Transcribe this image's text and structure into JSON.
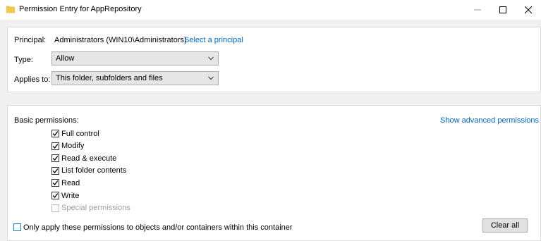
{
  "window": {
    "title": "Permission Entry for AppRepository",
    "icon": "folder-icon",
    "controls": [
      "minimize-icon",
      "maximize-icon",
      "close-icon"
    ]
  },
  "principal": {
    "label": "Principal:",
    "value": "Administrators (WIN10\\Administrators)",
    "link": "Select a principal"
  },
  "type": {
    "label": "Type:",
    "selected": "Allow"
  },
  "applies_to": {
    "label": "Applies to:",
    "selected": "This folder, subfolders and files"
  },
  "permissions": {
    "header": "Basic permissions:",
    "advanced_link": "Show advanced permissions",
    "items": [
      {
        "label": "Full control",
        "checked": true,
        "enabled": true
      },
      {
        "label": "Modify",
        "checked": true,
        "enabled": true
      },
      {
        "label": "Read & execute",
        "checked": true,
        "enabled": true
      },
      {
        "label": "List folder contents",
        "checked": true,
        "enabled": true
      },
      {
        "label": "Read",
        "checked": true,
        "enabled": true
      },
      {
        "label": "Write",
        "checked": true,
        "enabled": true
      },
      {
        "label": "Special permissions",
        "checked": false,
        "enabled": false
      }
    ],
    "only_apply_label": "Only apply these permissions to objects and/or containers within this container",
    "only_apply_checked": false,
    "clear_all": "Clear all"
  },
  "colors": {
    "link": "#0066cc",
    "folder": "#f7c948",
    "checkbox_focus": "#1f78d1"
  }
}
